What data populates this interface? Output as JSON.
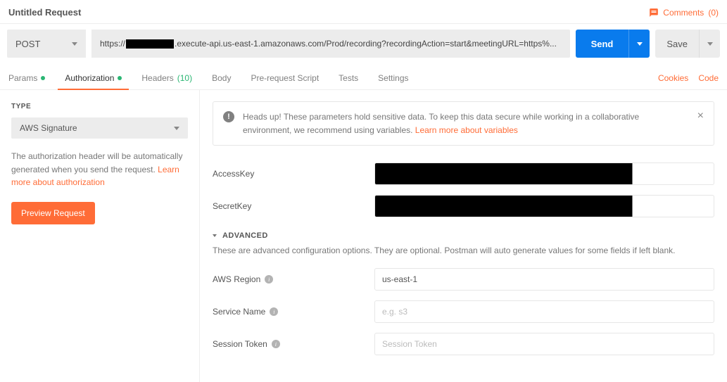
{
  "header": {
    "title": "Untitled Request",
    "comments_label": "Comments",
    "comments_count": "0"
  },
  "request": {
    "method": "POST",
    "url_prefix": "https://",
    "url_suffix": ".execute-api.us-east-1.amazonaws.com/Prod/recording?recordingAction=start&meetingURL=https%...",
    "send_label": "Send",
    "save_label": "Save"
  },
  "tabs": {
    "params": "Params",
    "authorization": "Authorization",
    "headers": "Headers",
    "headers_count": "(10)",
    "body": "Body",
    "pre_request": "Pre-request Script",
    "tests": "Tests",
    "settings": "Settings",
    "cookies": "Cookies",
    "code": "Code"
  },
  "left": {
    "type_label": "TYPE",
    "type_value": "AWS Signature",
    "auth_desc": "The authorization header will be automatically generated when you send the request. ",
    "auth_link": "Learn more about authorization",
    "preview_label": "Preview Request"
  },
  "notice": {
    "text": "Heads up! These parameters hold sensitive data. To keep this data secure while working in a collaborative environment, we recommend using variables. ",
    "link": "Learn more about variables"
  },
  "form": {
    "access_key_label": "AccessKey",
    "secret_key_label": "SecretKey",
    "advanced_label": "ADVANCED",
    "advanced_desc": "These are advanced configuration options. They are optional. Postman will auto generate values for some fields if left blank.",
    "aws_region_label": "AWS Region",
    "aws_region_value": "us-east-1",
    "service_name_label": "Service Name",
    "service_name_placeholder": "e.g. s3",
    "session_token_label": "Session Token",
    "session_token_placeholder": "Session Token"
  }
}
